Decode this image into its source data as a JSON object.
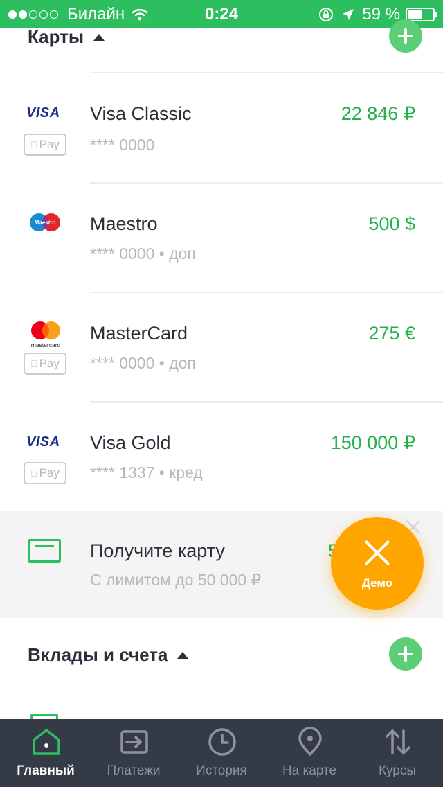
{
  "status_bar": {
    "carrier": "Билайн",
    "time": "0:24",
    "battery_percent": "59 %",
    "battery_level": 0.59,
    "signal_bars_filled": 2,
    "signal_bars_total": 5,
    "background_color": "#2dbf5f"
  },
  "cards_section": {
    "title": "Карты",
    "cards": [
      {
        "brand": "VISA",
        "apple_pay": "Pay",
        "name": "Visa Classic",
        "number": "**** 0000",
        "amount": "22 846 ₽"
      },
      {
        "brand": "Maestro",
        "name": "Maestro",
        "number": "**** 0000 • доп",
        "amount": "500 $"
      },
      {
        "brand": "mastercard",
        "apple_pay": "Pay",
        "name": "MasterCard",
        "number": "**** 0000 • доп",
        "amount": "275 €"
      },
      {
        "brand": "VISA",
        "apple_pay": "Pay",
        "name": "Visa Gold",
        "number": "**** 1337 • кред",
        "amount": "150 000 ₽"
      }
    ]
  },
  "promo_banner": {
    "title": "Получите карту",
    "subtitle": "С лимитом до 50 000 ₽",
    "peek_amount": "5"
  },
  "demo_fab": {
    "label": "Демо",
    "color": "#ffa500"
  },
  "deposits_section": {
    "title": "Вклады и счета"
  },
  "tab_bar": {
    "tabs": [
      {
        "label": "Главный",
        "icon": "home-icon",
        "active": true
      },
      {
        "label": "Платежи",
        "icon": "payments-icon",
        "active": false
      },
      {
        "label": "История",
        "icon": "clock-icon",
        "active": false
      },
      {
        "label": "На карте",
        "icon": "map-pin-icon",
        "active": false
      },
      {
        "label": "Курсы",
        "icon": "exchange-arrows-icon",
        "active": false
      }
    ]
  },
  "colors": {
    "accent_green": "#2dbf5f",
    "amount_green": "#22b04b",
    "tabbar_bg": "#343a46"
  }
}
